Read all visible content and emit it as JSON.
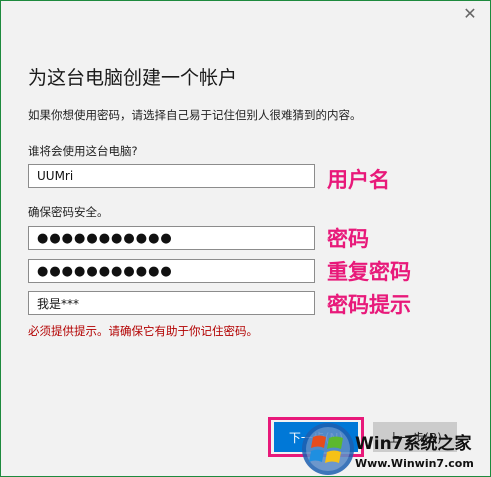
{
  "dialog": {
    "heading": "为这台电脑创建一个帐户",
    "description": "如果你想使用密码，请选择自己易于记住但别人很难猜到的内容。",
    "close_symbol": "✕"
  },
  "fields": {
    "username": {
      "label": "谁将会使用这台电脑?",
      "value": "UUMri",
      "annotation": "用户名"
    },
    "password": {
      "label": "确保密码安全。",
      "value": "●●●●●●●●●●●",
      "annotation": "密码"
    },
    "confirm_password": {
      "value": "●●●●●●●●●●●",
      "annotation": "重复密码"
    },
    "hint": {
      "value": "我是***",
      "annotation": "密码提示"
    }
  },
  "error_message": "必须提供提示。请确保它有助于你记住密码。",
  "buttons": {
    "next_label": "下一步(N)",
    "back_label": "上一步(B)"
  },
  "watermark": {
    "title": "Win7系统之家",
    "url": "Www.Winwin7.com"
  },
  "colors": {
    "accent": "#0078d7",
    "annotation": "#e8197a",
    "error": "#b30000"
  }
}
